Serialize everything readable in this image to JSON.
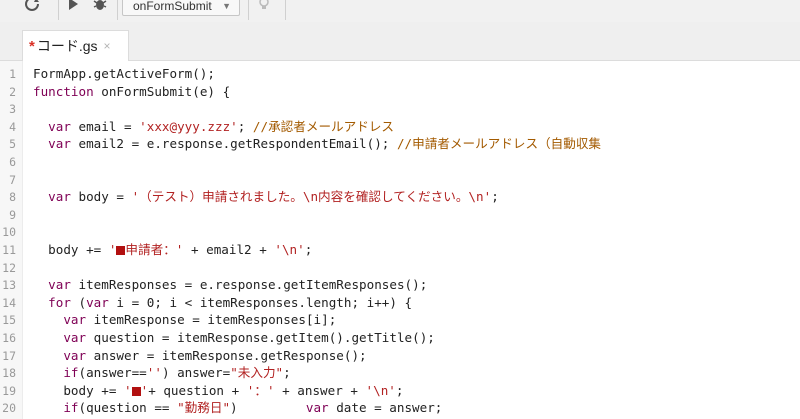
{
  "toolbar": {
    "function_select": "onFormSubmit"
  },
  "tab": {
    "modified_mark": "*",
    "filename": "コード.gs",
    "close": "×"
  },
  "code": {
    "lines": [
      {
        "n": "1",
        "parts": [
          [
            "t",
            "FormApp.getActiveForm();"
          ]
        ]
      },
      {
        "n": "2",
        "parts": [
          [
            "k",
            "function"
          ],
          [
            "t",
            " onFormSubmit(e) {"
          ]
        ]
      },
      {
        "n": "3",
        "parts": []
      },
      {
        "n": "4",
        "parts": [
          [
            "t",
            "  "
          ],
          [
            "k",
            "var"
          ],
          [
            "t",
            " email = "
          ],
          [
            "s",
            "'xxx@yyy.zzz'"
          ],
          [
            "t",
            "; "
          ],
          [
            "c",
            "//承認者メールアドレス"
          ]
        ]
      },
      {
        "n": "5",
        "parts": [
          [
            "t",
            "  "
          ],
          [
            "k",
            "var"
          ],
          [
            "t",
            " email2 = e.response.getRespondentEmail(); "
          ],
          [
            "c",
            "//申請者メールアドレス（自動収集"
          ]
        ]
      },
      {
        "n": "6",
        "parts": []
      },
      {
        "n": "7",
        "parts": []
      },
      {
        "n": "8",
        "parts": [
          [
            "t",
            "  "
          ],
          [
            "k",
            "var"
          ],
          [
            "t",
            " body = "
          ],
          [
            "s",
            "'（テスト）申請されました。\\n内容を確認してください。\\n'"
          ],
          [
            "t",
            ";"
          ]
        ]
      },
      {
        "n": "9",
        "parts": []
      },
      {
        "n": "10",
        "parts": []
      },
      {
        "n": "11",
        "parts": [
          [
            "t",
            "  body += "
          ],
          [
            "s",
            "'"
          ],
          [
            "q",
            ""
          ],
          [
            "s",
            "申請者：'"
          ],
          [
            "t",
            " + email2 + "
          ],
          [
            "s",
            "'\\n'"
          ],
          [
            "t",
            ";"
          ]
        ]
      },
      {
        "n": "12",
        "parts": []
      },
      {
        "n": "13",
        "parts": [
          [
            "t",
            "  "
          ],
          [
            "k",
            "var"
          ],
          [
            "t",
            " itemResponses = e.response.getItemResponses();"
          ]
        ]
      },
      {
        "n": "14",
        "parts": [
          [
            "t",
            "  "
          ],
          [
            "k",
            "for"
          ],
          [
            "t",
            " ("
          ],
          [
            "k",
            "var"
          ],
          [
            "t",
            " i = 0; i < itemResponses.length; i++) {"
          ]
        ]
      },
      {
        "n": "15",
        "parts": [
          [
            "t",
            "    "
          ],
          [
            "k",
            "var"
          ],
          [
            "t",
            " itemResponse = itemResponses[i];"
          ]
        ]
      },
      {
        "n": "16",
        "parts": [
          [
            "t",
            "    "
          ],
          [
            "k",
            "var"
          ],
          [
            "t",
            " question = itemResponse.getItem().getTitle();"
          ]
        ]
      },
      {
        "n": "17",
        "parts": [
          [
            "t",
            "    "
          ],
          [
            "k",
            "var"
          ],
          [
            "t",
            " answer = itemResponse.getResponse();"
          ]
        ]
      },
      {
        "n": "18",
        "parts": [
          [
            "t",
            "    "
          ],
          [
            "k",
            "if"
          ],
          [
            "t",
            "(answer=="
          ],
          [
            "s",
            "''"
          ],
          [
            "t",
            ") answer="
          ],
          [
            "s",
            "\"未入力\""
          ],
          [
            "t",
            ";"
          ]
        ]
      },
      {
        "n": "19",
        "parts": [
          [
            "t",
            "    body += "
          ],
          [
            "s",
            "'"
          ],
          [
            "q",
            ""
          ],
          [
            "s",
            "'"
          ],
          [
            "t",
            "+ question + "
          ],
          [
            "s",
            "'：'"
          ],
          [
            "t",
            " + answer + "
          ],
          [
            "s",
            "'\\n'"
          ],
          [
            "t",
            ";"
          ]
        ]
      },
      {
        "n": "20",
        "parts": [
          [
            "t",
            "    "
          ],
          [
            "k",
            "if"
          ],
          [
            "t",
            "(question == "
          ],
          [
            "s",
            "\"勤務日\""
          ],
          [
            "t",
            ")         "
          ],
          [
            "k",
            "var"
          ],
          [
            "t",
            " date = answer;"
          ]
        ]
      }
    ]
  }
}
